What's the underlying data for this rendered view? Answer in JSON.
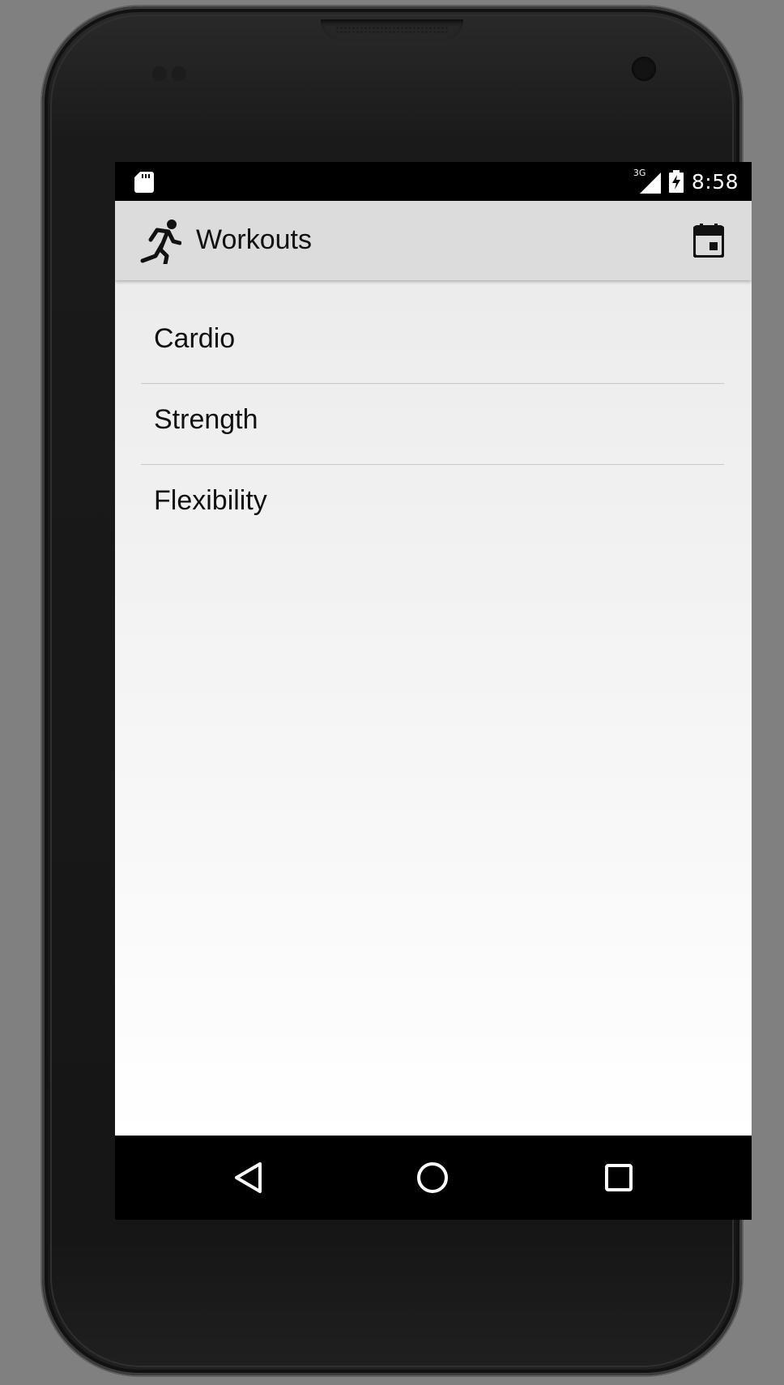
{
  "status_bar": {
    "network": "3G",
    "time": "8:58",
    "icons": [
      "sd-card-icon",
      "signal-icon",
      "battery-charging-icon"
    ]
  },
  "app_bar": {
    "title": "Workouts",
    "leading_icon": "running-person-icon",
    "action_icon": "calendar-icon"
  },
  "workouts": {
    "items": [
      {
        "label": "Cardio"
      },
      {
        "label": "Strength"
      },
      {
        "label": "Flexibility"
      }
    ]
  },
  "nav_bar": {
    "icons": [
      "back-icon",
      "home-icon",
      "recents-icon"
    ]
  },
  "colors": {
    "app_bar": "#dcdcdc",
    "divider": "#c8c8c8",
    "text": "#111111",
    "system_bar": "#000000"
  }
}
